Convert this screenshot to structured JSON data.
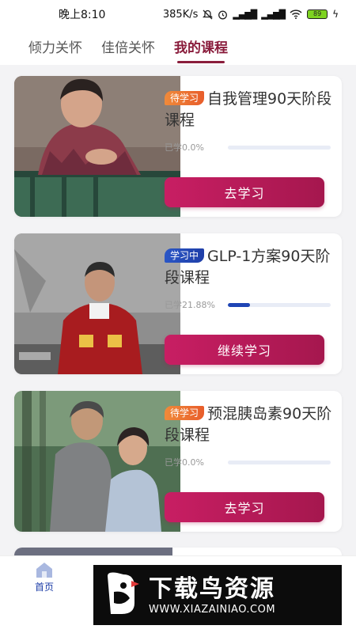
{
  "status_bar": {
    "time": "晚上8:10",
    "speed": "385K/s",
    "signal1": "HD",
    "signal2": "HD",
    "battery": "89"
  },
  "tabs": [
    {
      "label": "倾力关怀",
      "active": false
    },
    {
      "label": "佳倍关怀",
      "active": false
    },
    {
      "label": "我的课程",
      "active": true
    }
  ],
  "courses": [
    {
      "badge": "待学习",
      "badge_type": "pending",
      "title": "自我管理90天阶段课程",
      "progress_text": "已学0.0%",
      "progress": 0.0,
      "button": "去学习"
    },
    {
      "badge": "学习中",
      "badge_type": "learning",
      "title": "GLP-1方案90天阶段课程",
      "progress_text": "已学21.88%",
      "progress": 21.88,
      "button": "继续学习"
    },
    {
      "badge": "待学习",
      "badge_type": "pending",
      "title": "预混胰岛素90天阶段课程",
      "progress_text": "已学0.0%",
      "progress": 0.0,
      "button": "去学习"
    }
  ],
  "bottom_nav": {
    "home": "首页",
    "home_icon": "home-icon"
  },
  "watermark": {
    "title": "下载鸟资源",
    "url": "WWW.XIAZAINIAO.COM"
  },
  "colors": {
    "accent": "#8a1d3c",
    "button": "#b81a58",
    "pending": "#e8702f",
    "learning": "#1f45b5"
  }
}
